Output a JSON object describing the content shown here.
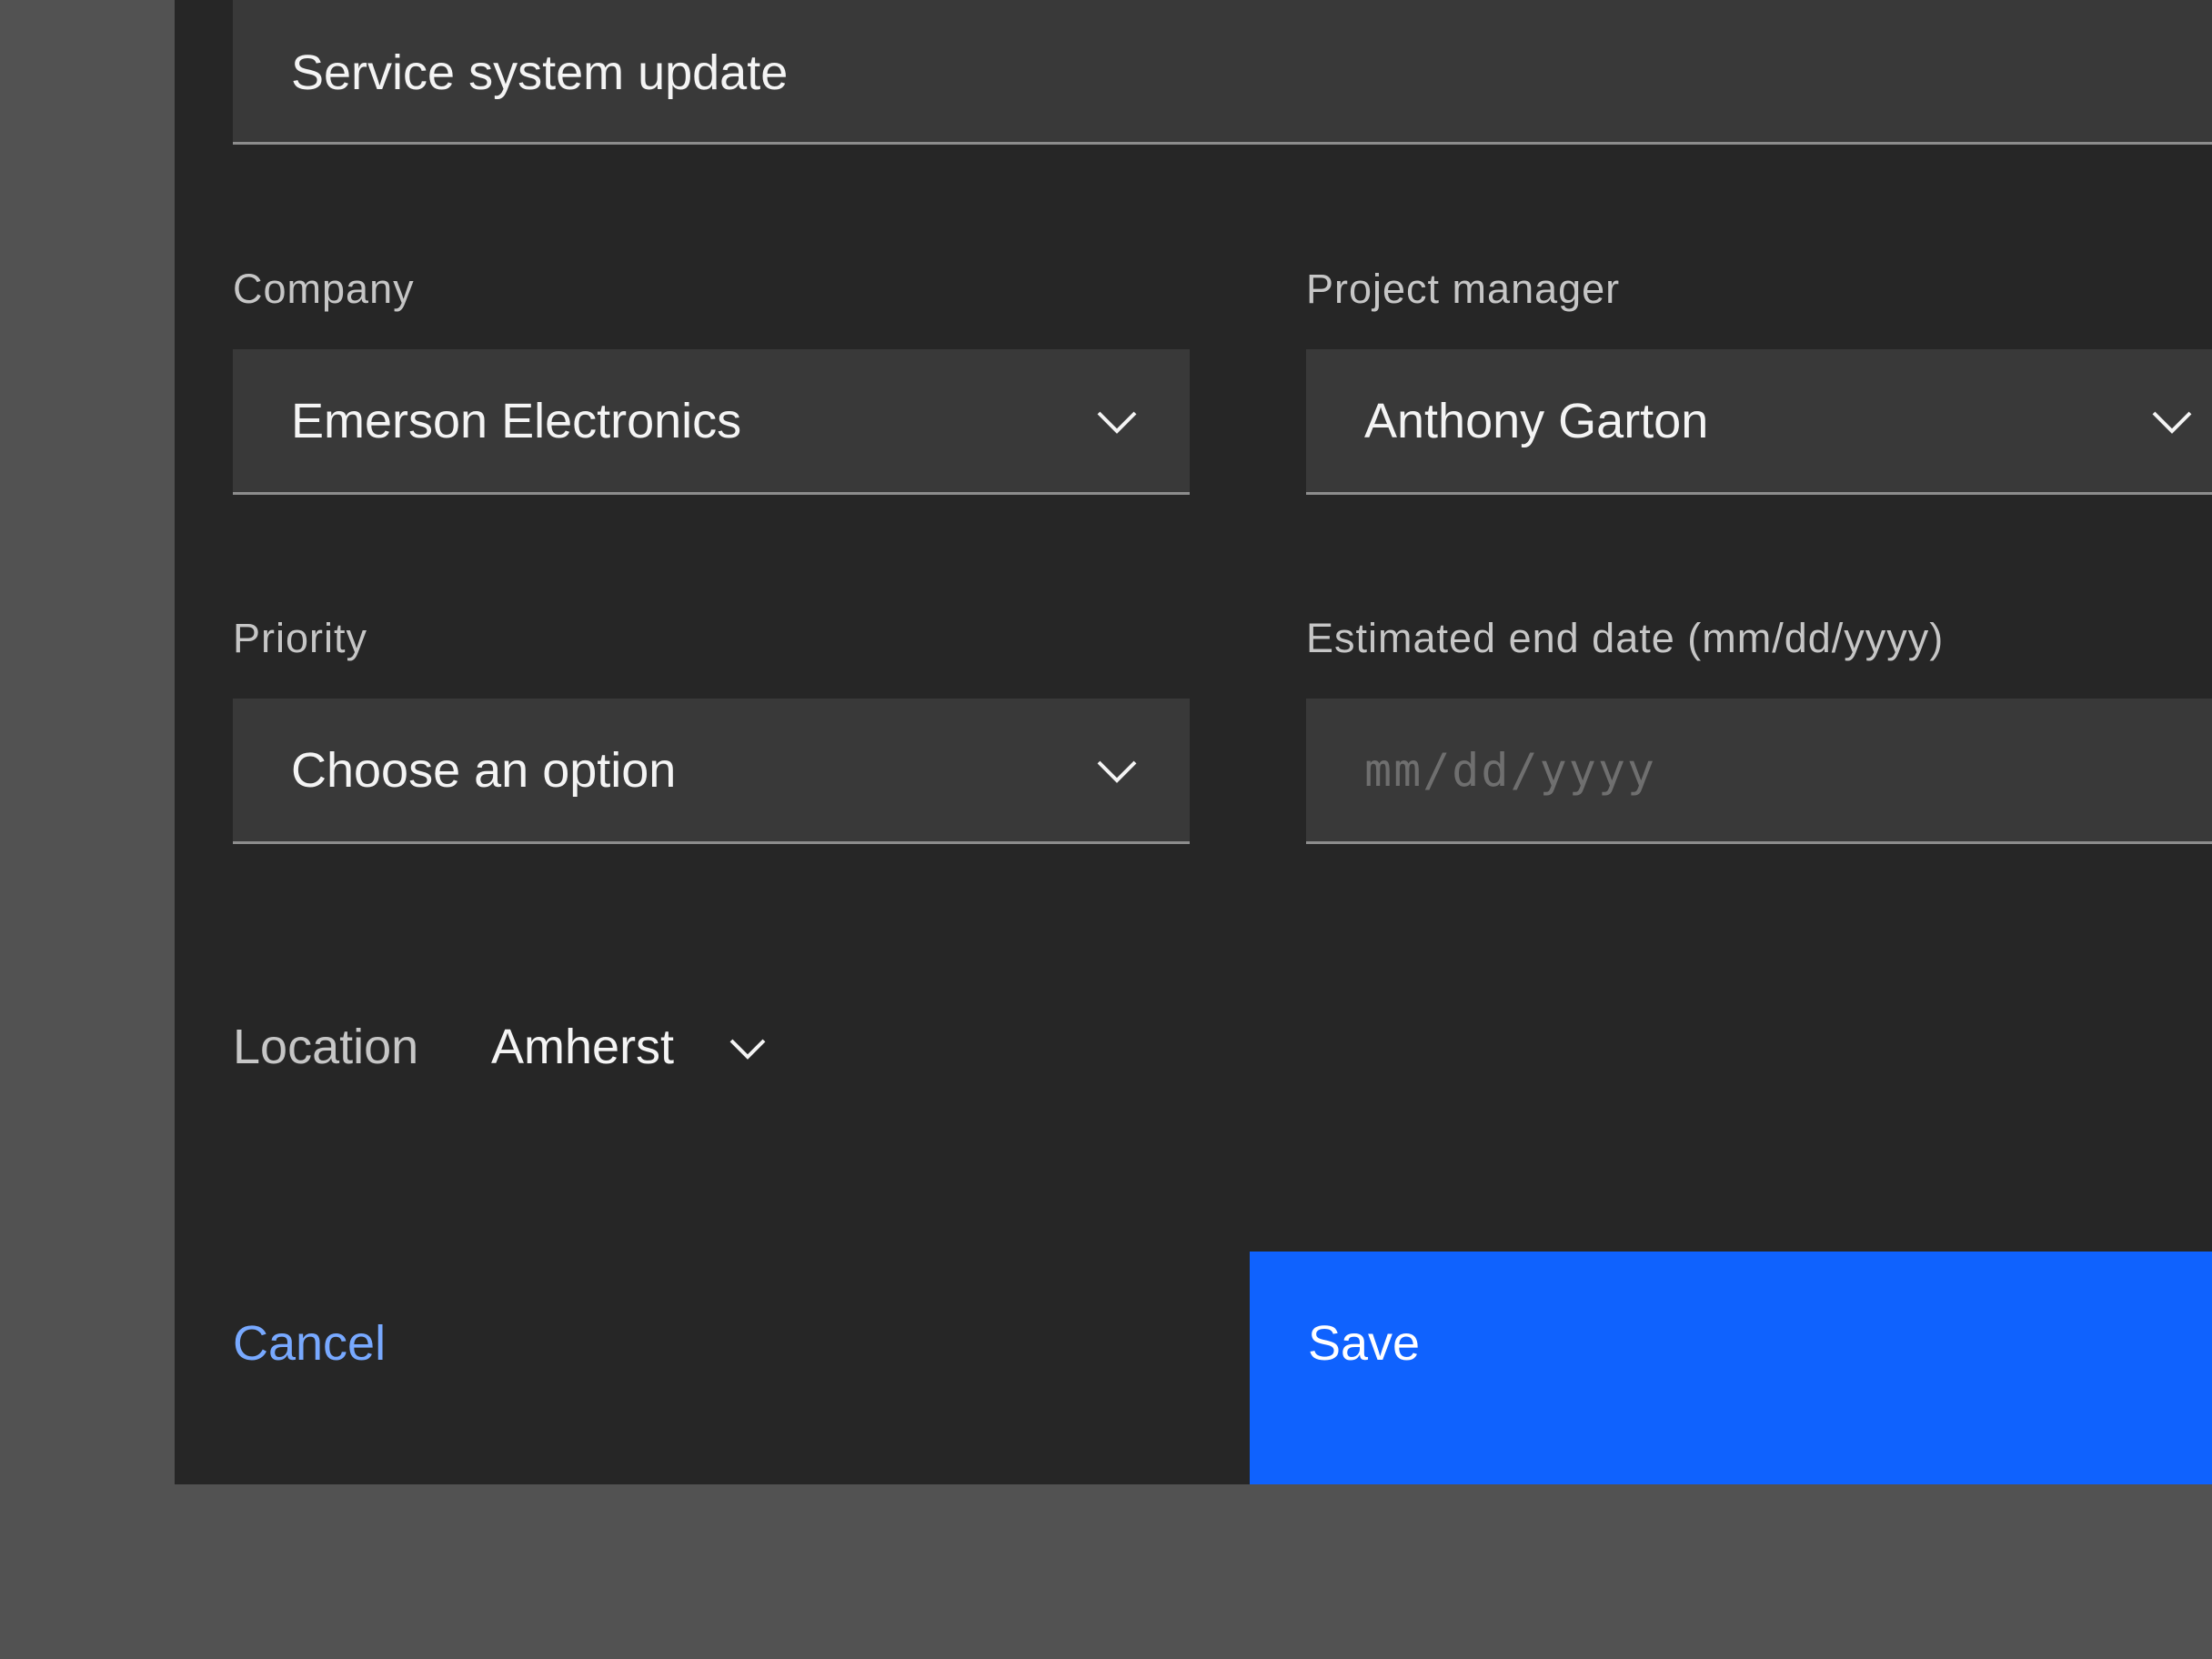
{
  "form": {
    "title_field": {
      "value": "Service system update"
    },
    "company": {
      "label": "Company",
      "selected": "Emerson Electronics"
    },
    "project_manager": {
      "label": "Project manager",
      "selected": "Anthony Garton"
    },
    "priority": {
      "label": "Priority",
      "selected": "Choose an option"
    },
    "end_date": {
      "label": "Estimated end date (mm/dd/yyyy)",
      "placeholder": "mm/dd/yyyy",
      "value": ""
    },
    "location": {
      "label": "Location",
      "selected": "Amherst"
    }
  },
  "actions": {
    "cancel_label": "Cancel",
    "save_label": "Save"
  },
  "colors": {
    "backdrop": "#525252",
    "modal_background": "#262626",
    "field_background": "#393939",
    "primary_button": "#0f62fe",
    "link": "#78a9ff"
  },
  "icons": {
    "dropdown": "chevron-down-icon"
  }
}
